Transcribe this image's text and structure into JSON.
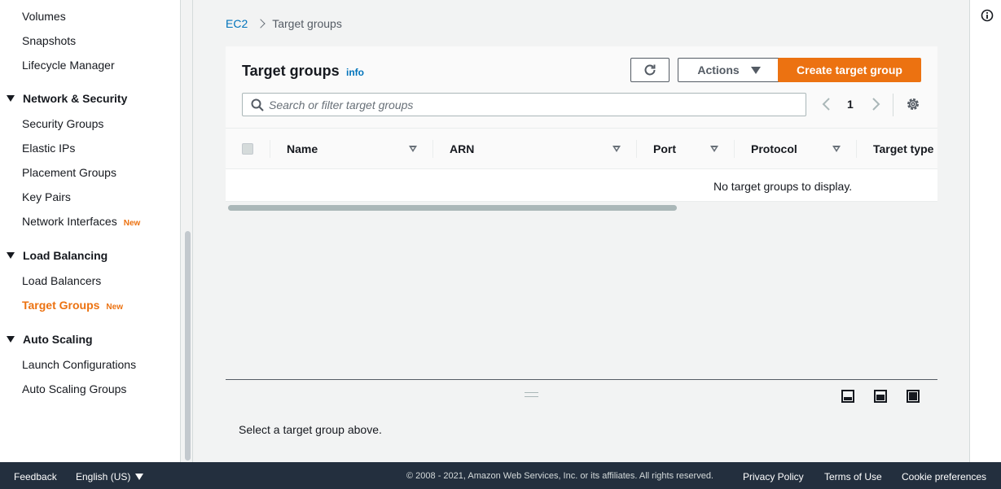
{
  "sidebar": {
    "items_top": [
      "Volumes",
      "Snapshots",
      "Lifecycle Manager"
    ],
    "network_section": "Network & Security",
    "network_items": [
      "Security Groups",
      "Elastic IPs",
      "Placement Groups",
      "Key Pairs",
      "Network Interfaces"
    ],
    "new_badge": "New",
    "lb_section": "Load Balancing",
    "lb_items": [
      "Load Balancers",
      "Target Groups"
    ],
    "as_section": "Auto Scaling",
    "as_items": [
      "Launch Configurations",
      "Auto Scaling Groups"
    ]
  },
  "breadcrumb": {
    "root": "EC2",
    "current": "Target groups"
  },
  "panel": {
    "title": "Target groups",
    "info": "info",
    "actions_label": "Actions",
    "create_label": "Create target group",
    "search_placeholder": "Search or filter target groups",
    "page_number": "1",
    "columns": [
      "Name",
      "ARN",
      "Port",
      "Protocol",
      "Target type"
    ],
    "empty_message": "No target groups to display."
  },
  "split": {
    "message": "Select a target group above."
  },
  "footer": {
    "feedback": "Feedback",
    "language": "English (US)",
    "copyright": "© 2008 - 2021, Amazon Web Services, Inc. or its affiliates. All rights reserved.",
    "privacy": "Privacy Policy",
    "terms": "Terms of Use",
    "cookies": "Cookie preferences"
  },
  "colors": {
    "accent": "#ec7211",
    "link": "#0073bb",
    "footer_bg": "#232f3e"
  },
  "icons": [
    "refresh-icon",
    "search-icon",
    "chevron-left-icon",
    "chevron-right-icon",
    "settings-icon",
    "info-icon",
    "split-bottom-icon",
    "split-side-icon",
    "split-full-icon"
  ]
}
